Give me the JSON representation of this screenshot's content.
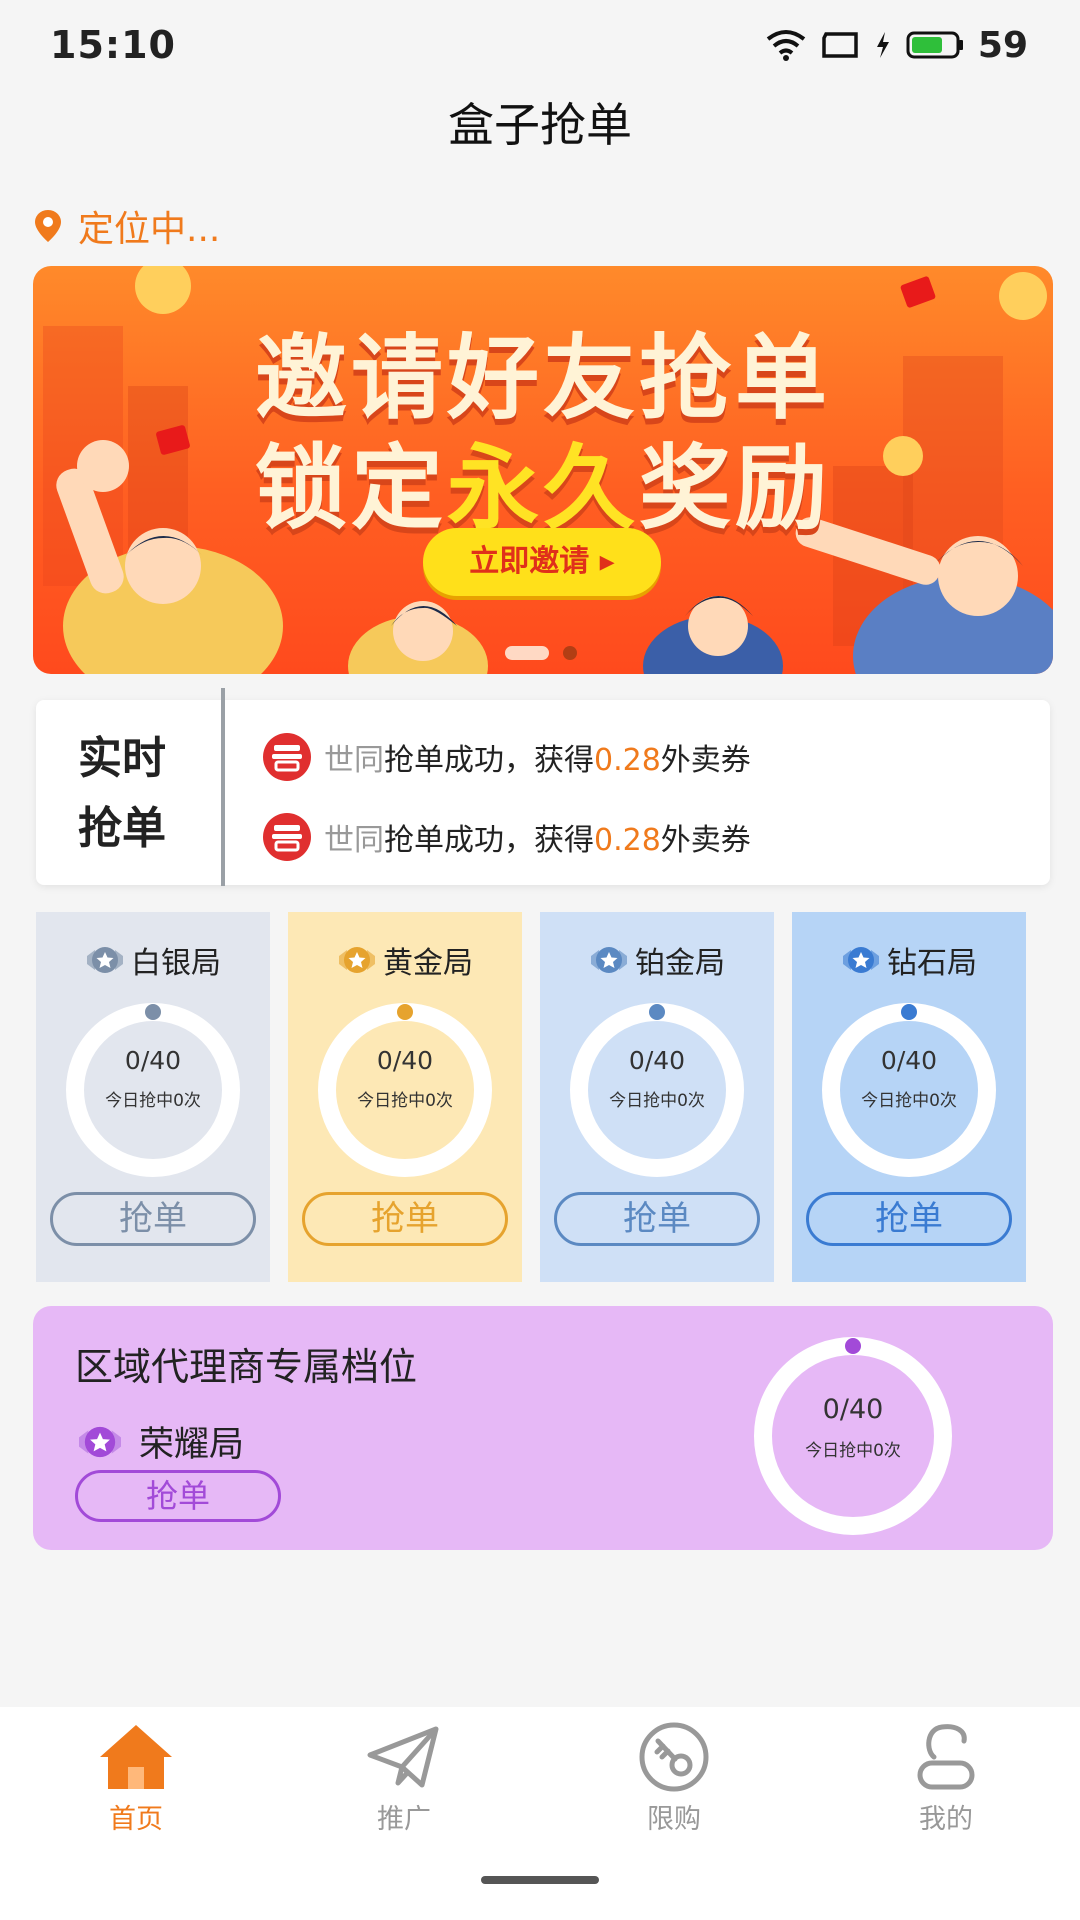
{
  "status_bar": {
    "time": "15:10",
    "battery": "59"
  },
  "header": {
    "title": "盒子抢单"
  },
  "location": {
    "text": "定位中..."
  },
  "banner": {
    "line1": "邀请好友抢单",
    "line2_prefix": "锁定",
    "line2_highlight": "永久",
    "line2_suffix": "奖励",
    "button_label": "立即邀请 ▸",
    "slide_count": 2,
    "active_slide": 1
  },
  "realtime": {
    "title_line1": "实时",
    "title_line2": "抢单",
    "items": [
      {
        "user": "世同",
        "text_before": "抢单成功，获得",
        "amount": "0.28",
        "text_after": "外卖券"
      },
      {
        "user": "世同",
        "text_before": "抢单成功，获得",
        "amount": "0.28",
        "text_after": "外卖券"
      }
    ]
  },
  "tiers": [
    {
      "name": "白银局",
      "value": "0/40",
      "sub": "今日抢中0次",
      "button": "抢单",
      "color": "#7c8fa8",
      "bg": "#e2e6ee",
      "progress": 0
    },
    {
      "name": "黄金局",
      "value": "0/40",
      "sub": "今日抢中0次",
      "button": "抢单",
      "color": "#e6a32e",
      "bg": "#fde8b5",
      "progress": 0
    },
    {
      "name": "铂金局",
      "value": "0/40",
      "sub": "今日抢中0次",
      "button": "抢单",
      "color": "#5b89c2",
      "bg": "#cfe0f6",
      "progress": 0
    },
    {
      "name": "钻石局",
      "value": "0/40",
      "sub": "今日抢中0次",
      "button": "抢单",
      "color": "#3a7bd2",
      "bg": "#b6d4f6",
      "progress": 0
    }
  ],
  "honor": {
    "title": "区域代理商专属档位",
    "name": "荣耀局",
    "button": "抢单",
    "value": "0/40",
    "sub": "今日抢中0次",
    "color": "#a24ad8",
    "progress": 0
  },
  "tabbar": {
    "items": [
      {
        "label": "首页",
        "icon": "home-icon",
        "active": true
      },
      {
        "label": "推广",
        "icon": "paper-plane-icon",
        "active": false
      },
      {
        "label": "限购",
        "icon": "key-icon",
        "active": false
      },
      {
        "label": "我的",
        "icon": "user-icon",
        "active": false
      }
    ],
    "active_color": "#f07a1c",
    "inactive_color": "#999999"
  }
}
